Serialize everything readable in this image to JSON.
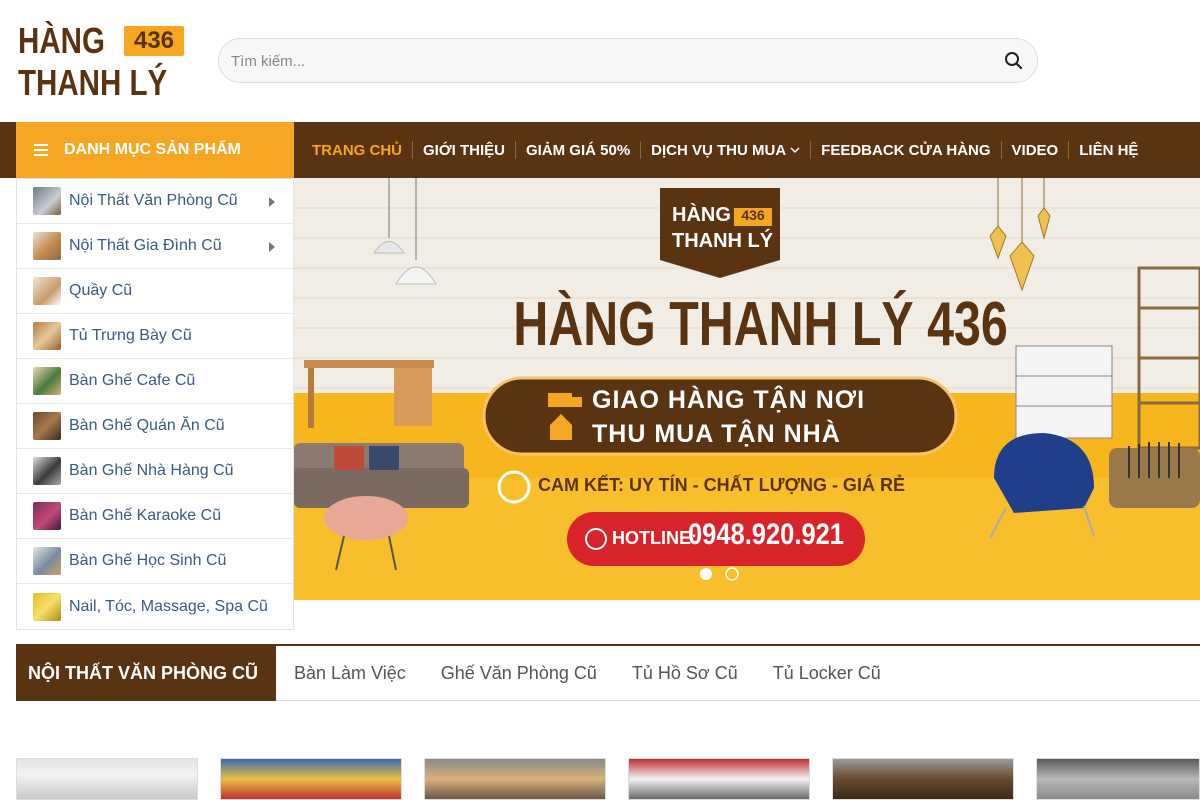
{
  "logo": {
    "line1": "HÀNG",
    "badge": "436",
    "line2": "THANH LÝ"
  },
  "search": {
    "placeholder": "Tìm kiếm..."
  },
  "category_button": {
    "label": "DANH MỤC SẢN PHẨM"
  },
  "nav": {
    "items": [
      {
        "label": "TRANG CHỦ"
      },
      {
        "label": "GIỚI THIỆU"
      },
      {
        "label": "GIẢM GIÁ 50%"
      },
      {
        "label": "DỊCH VỤ THU MUA"
      },
      {
        "label": "FEEDBACK CỬA HÀNG"
      },
      {
        "label": "VIDEO"
      },
      {
        "label": "LIÊN HỆ"
      }
    ]
  },
  "sidebar": {
    "items": [
      {
        "label": "Nội Thất Văn Phòng Cũ"
      },
      {
        "label": "Nội Thất Gia Đình Cũ"
      },
      {
        "label": "Quầy Cũ"
      },
      {
        "label": "Tủ Trưng Bày Cũ"
      },
      {
        "label": "Bàn Ghế Cafe Cũ"
      },
      {
        "label": "Bàn Ghế Quán Ăn Cũ"
      },
      {
        "label": "Bàn Ghế Nhà Hàng Cũ"
      },
      {
        "label": "Bàn Ghế Karaoke Cũ"
      },
      {
        "label": "Bàn Ghế Học Sinh Cũ"
      },
      {
        "label": "Nail, Tóc, Massage, Spa Cũ"
      }
    ]
  },
  "banner": {
    "logo_line1": "HÀNG",
    "logo_badge": "436",
    "logo_line2": "THANH LÝ",
    "headline": "HÀNG THANH LÝ 436",
    "line1": "GIAO HÀNG TẬN NƠI",
    "line2": "THU MUA TẬN NHÀ",
    "commit": "CAM KẾT: UY TÍN - CHẤT LƯỢNG - GIÁ RẺ",
    "hotline_label": "HOTLINE:",
    "hotline_number": "0948.920.921"
  },
  "section": {
    "title": "NỘI THẤT VĂN PHÒNG CŨ",
    "tabs": [
      {
        "label": "Bàn Làm Việc"
      },
      {
        "label": "Ghế Văn Phòng Cũ"
      },
      {
        "label": "Tủ Hồ Sơ Cũ"
      },
      {
        "label": "Tủ Locker Cũ"
      }
    ]
  },
  "colors": {
    "brown": "#5a3310",
    "orange": "#f5a623",
    "red": "#d8232a",
    "link": "#3a5a85"
  }
}
